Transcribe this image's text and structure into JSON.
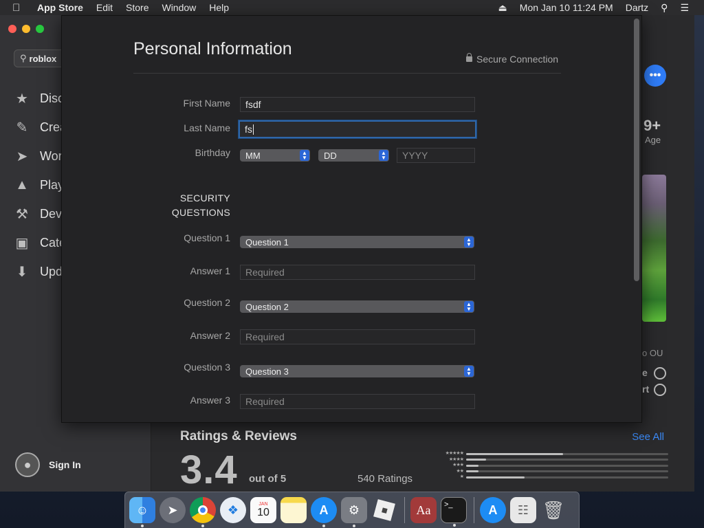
{
  "menubar": {
    "apple_icon": "apple-logo-icon",
    "app_name": "App Store",
    "menus": [
      "Edit",
      "Store",
      "Window",
      "Help"
    ],
    "datetime": "Mon Jan 10  11:24 PM",
    "user": "Dartz"
  },
  "sidebar": {
    "search_value": "roblox",
    "items": [
      {
        "label": "Disc",
        "icon": "star-icon"
      },
      {
        "label": "Crea",
        "icon": "brush-icon"
      },
      {
        "label": "Wor",
        "icon": "paper-plane-icon"
      },
      {
        "label": "Play",
        "icon": "rocket-icon"
      },
      {
        "label": "Dev",
        "icon": "hammer-icon"
      },
      {
        "label": "Cate",
        "icon": "categories-icon"
      },
      {
        "label": "Upd",
        "icon": "download-icon"
      }
    ],
    "sign_in": "Sign In"
  },
  "right_column": {
    "more_label": "•••",
    "age": "9+",
    "age_label": "Age",
    "text1": "o OU",
    "text2": "e",
    "text3": "rt"
  },
  "ratings": {
    "title": "Ratings & Reviews",
    "see_all": "See All",
    "score": "3.4",
    "out_of": "out of 5",
    "count": "540 Ratings",
    "distribution": [
      {
        "stars": "★★★★★",
        "fraction": 0.48
      },
      {
        "stars": "★★★★",
        "fraction": 0.1
      },
      {
        "stars": "★★★",
        "fraction": 0.06
      },
      {
        "stars": "★★",
        "fraction": 0.06
      },
      {
        "stars": "★",
        "fraction": 0.29
      }
    ]
  },
  "sheet": {
    "title": "Personal Information",
    "secure": "Secure Connection",
    "first_name_label": "First Name",
    "first_name_value": "fsdf",
    "last_name_label": "Last Name",
    "last_name_value": "fs",
    "birthday_label": "Birthday",
    "birthday_month": "MM",
    "birthday_day": "DD",
    "birthday_year_placeholder": "YYYY",
    "security_line1": "SECURITY",
    "security_line2": "QUESTIONS",
    "questions": [
      {
        "q_label": "Question 1",
        "q_value": "Question 1",
        "a_label": "Answer 1",
        "a_placeholder": "Required"
      },
      {
        "q_label": "Question 2",
        "q_value": "Question 2",
        "a_label": "Answer 2",
        "a_placeholder": "Required"
      },
      {
        "q_label": "Question 3",
        "q_value": "Question 3",
        "a_label": "Answer 3",
        "a_placeholder": "Required"
      }
    ]
  },
  "dock": {
    "calendar_month": "JAN",
    "calendar_day": "10",
    "dictionary_label": "Aa",
    "terminal_label": ">_",
    "apps": [
      "finder-icon",
      "launchpad-icon",
      "chrome-icon",
      "safari-icon",
      "calendar-icon",
      "notes-icon",
      "app-store-icon",
      "system-preferences-icon",
      "roblox-icon",
      "dictionary-icon",
      "terminal-icon",
      "app-store-folder-icon",
      "document-icon",
      "trash-icon"
    ]
  },
  "colors": {
    "accent": "#2f7cf6",
    "focus_ring": "#2f67a9",
    "sheet_bg": "#232325"
  }
}
